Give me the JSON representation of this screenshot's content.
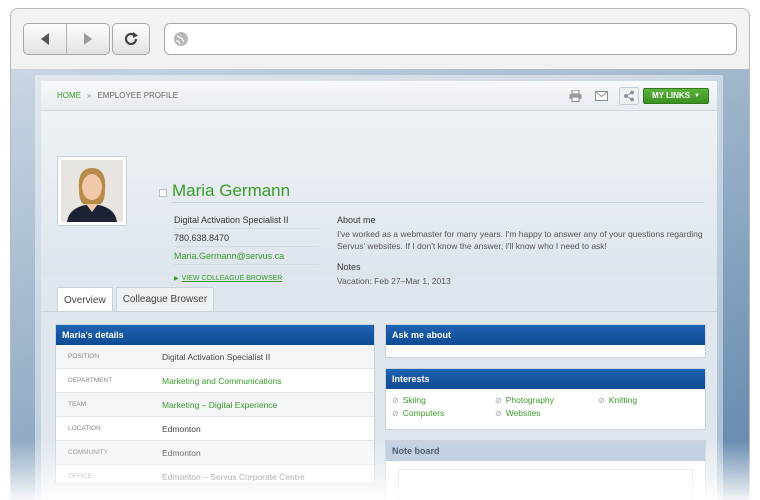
{
  "browser": {
    "back_icon": "back-arrow-icon",
    "forward_icon": "forward-arrow-icon",
    "reload_icon": "reload-icon",
    "url_icon": "globe-icon",
    "url": ""
  },
  "topbar": {
    "breadcrumb_home": "HOME",
    "breadcrumb_separator": "»",
    "breadcrumb_current": "EMPLOYEE PROFILE",
    "my_links_label": "MY LINKS",
    "accent": "#3c8f23"
  },
  "profile": {
    "name": "Maria Germann",
    "title": "Digital Activation Specialist II",
    "phone": "780.638.8470",
    "email": "Maria.Germann@servus.ca",
    "view_colleague_browser": "VIEW COLLEAGUE BROWSER",
    "about_heading": "About me",
    "about_text": "I've worked as a webmaster for many years.  I'm happy to answer any of your questions regarding Servus' websites. If I don't know the answer, I'll know who I need to ask!",
    "notes_heading": "Notes",
    "notes_text": "Vacation: Feb 27–Mar 1, 2013",
    "name_color": "#3a9a2a"
  },
  "tabs": [
    {
      "label": "Overview",
      "active": true
    },
    {
      "label": "Colleague Browser",
      "active": false
    }
  ],
  "details": {
    "heading": "Maria's details",
    "rows": [
      {
        "key": "POSITION",
        "value": "Digital Activation Specialist II"
      },
      {
        "key": "DEPARTMENT",
        "value": "Marketing and Communications"
      },
      {
        "key": "TEAM",
        "value": "Marketing – Digital Experience"
      },
      {
        "key": "LOCATION",
        "value": "Edmonton"
      },
      {
        "key": "COMMUNITY",
        "value": "Edmonton"
      },
      {
        "key": "OFFICE",
        "value": "Edmonton – Servus Corporate Centre"
      }
    ]
  },
  "ask_me": {
    "heading": "Ask me about"
  },
  "interests": {
    "heading": "Interests",
    "items": [
      "Skiing",
      "Photography",
      "Knitting",
      "Computers",
      "Websites"
    ]
  },
  "noteboard": {
    "heading": "Note board"
  },
  "colors": {
    "panel_header": "#1f63b3",
    "link_green": "#3a9a2a"
  }
}
